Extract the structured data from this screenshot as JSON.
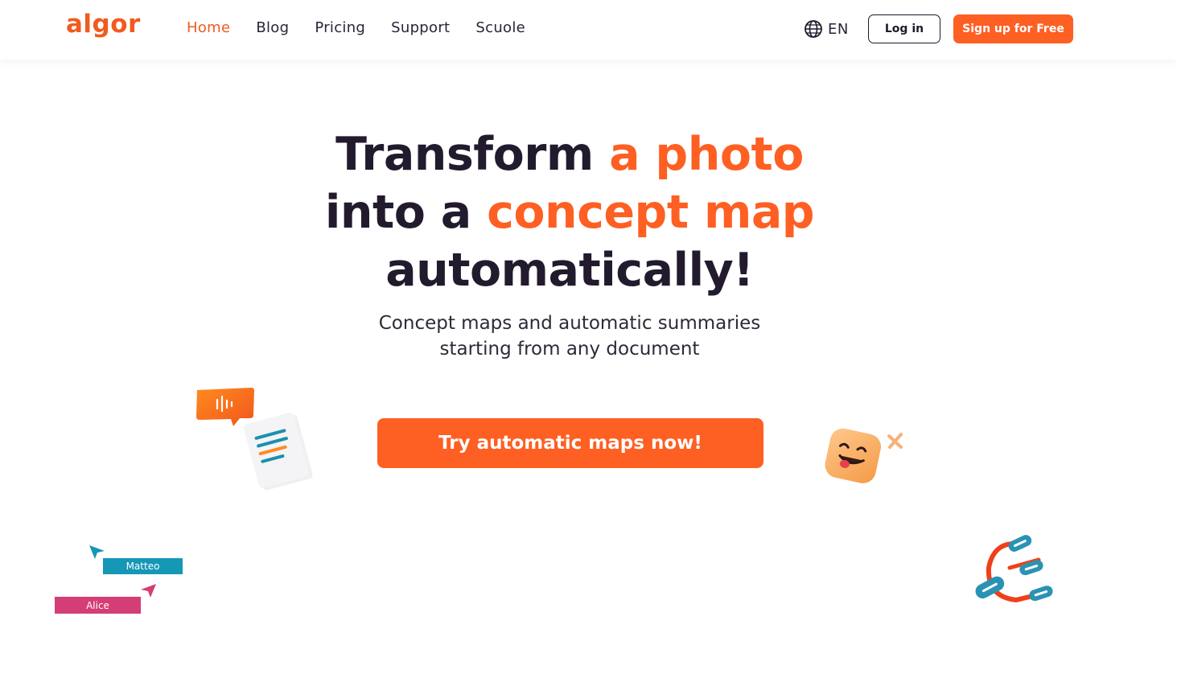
{
  "header": {
    "logo_text": "algor",
    "nav": [
      {
        "label": "Home",
        "active": true
      },
      {
        "label": "Blog",
        "active": false
      },
      {
        "label": "Pricing",
        "active": false
      },
      {
        "label": "Support",
        "active": false
      },
      {
        "label": "Scuole",
        "active": false
      }
    ],
    "language": {
      "icon": "globe-icon",
      "label": "EN"
    },
    "login_label": "Log in",
    "signup_label": "Sign up for Free"
  },
  "hero": {
    "title_part1": "Transform ",
    "title_highlight1": "a photo",
    "title_part2": "into a ",
    "title_highlight2": "concept map",
    "title_part3": "automatically!",
    "subtitle_line1": "Concept maps and automatic summaries",
    "subtitle_line2": "starting from any document",
    "cta_label": "Try automatic maps now!"
  },
  "decorations": {
    "collaborators": [
      {
        "name": "Matteo",
        "color": "#1597b6"
      },
      {
        "name": "Alice",
        "color": "#d43d75"
      }
    ],
    "icons": [
      "audio-bubble-icon",
      "document-icon",
      "smiley-face-icon",
      "sparkle-icon",
      "magnet-link-icon"
    ]
  },
  "colors": {
    "accent": "#fe5f22",
    "text": "#221b2e"
  }
}
